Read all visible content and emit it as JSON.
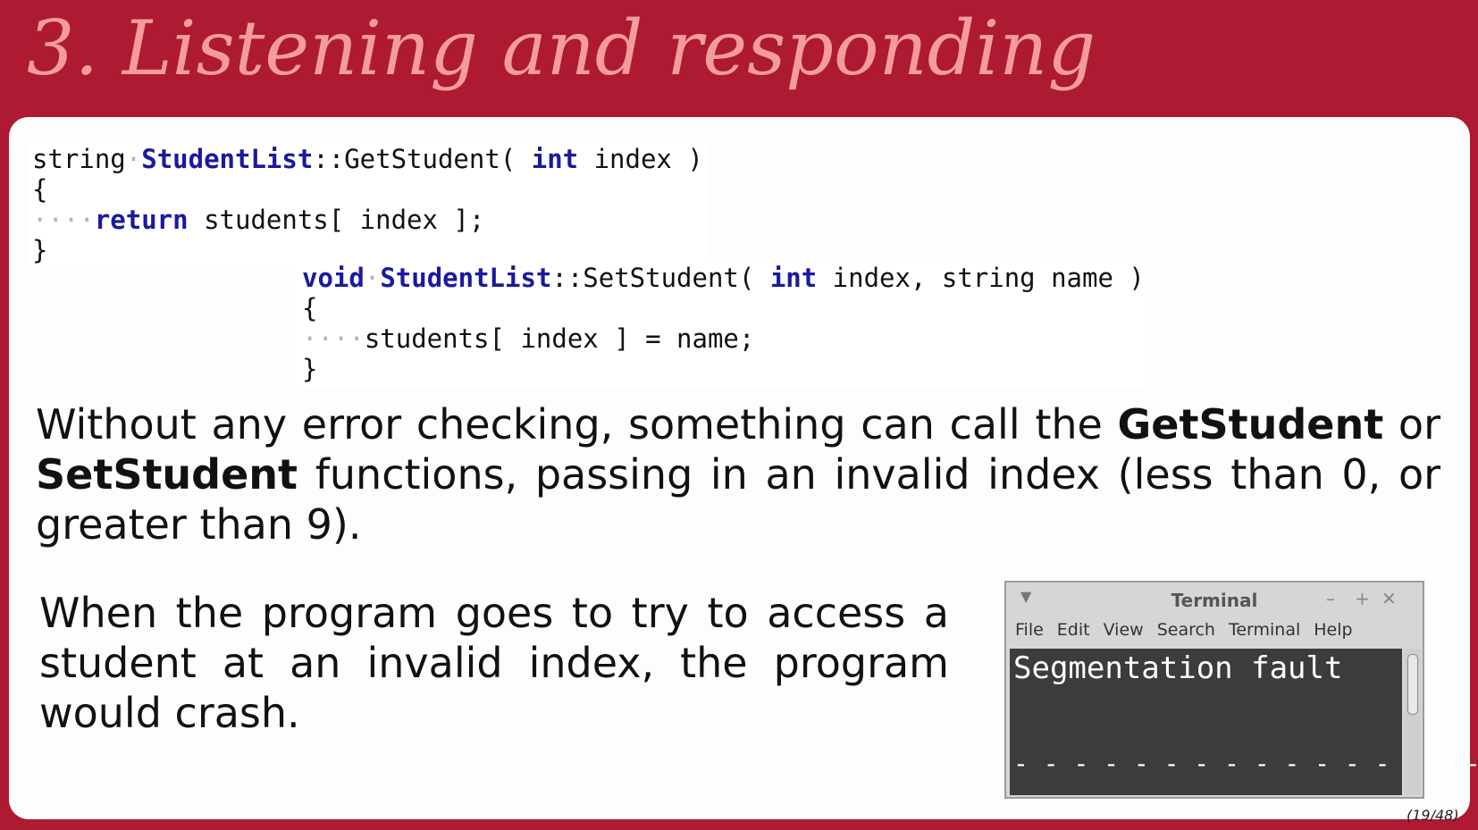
{
  "slide": {
    "title": "3. Listening and responding",
    "page_counter": "(19/48)"
  },
  "code_get": {
    "line1_type": "string",
    "line1_class": "StudentList",
    "line1_rest": "::GetStudent( ",
    "line1_kw": "int",
    "line1_param": " index )",
    "line2": "{",
    "line3_kw": "return",
    "line3_rest": " students[ index ];",
    "line4": "}"
  },
  "code_set": {
    "line1_kw": "void",
    "line1_class": "StudentList",
    "line1_rest": "::SetStudent( ",
    "line1_kw2": "int",
    "line1_param": " index, string name )",
    "line2": "{",
    "line3": "students[ index ] = name;",
    "line4": "}"
  },
  "paragraph1": {
    "text_a": "Without any error checking, something can call the ",
    "bold_a": "GetStudent",
    "text_b": " or ",
    "bold_b": "SetStudent",
    "text_c": " functions, passing in an invalid index (less than 0, or greater than 9)."
  },
  "paragraph2": {
    "text": "When the program goes to try to access a student at an invalid index, the program would crash."
  },
  "terminal": {
    "title": "Terminal",
    "menu_items": [
      "File",
      "Edit",
      "View",
      "Search",
      "Terminal",
      "Help"
    ],
    "output_line": "Segmentation fault",
    "prompt_line": "- - - - - - - - - - - - - - - - -"
  }
}
